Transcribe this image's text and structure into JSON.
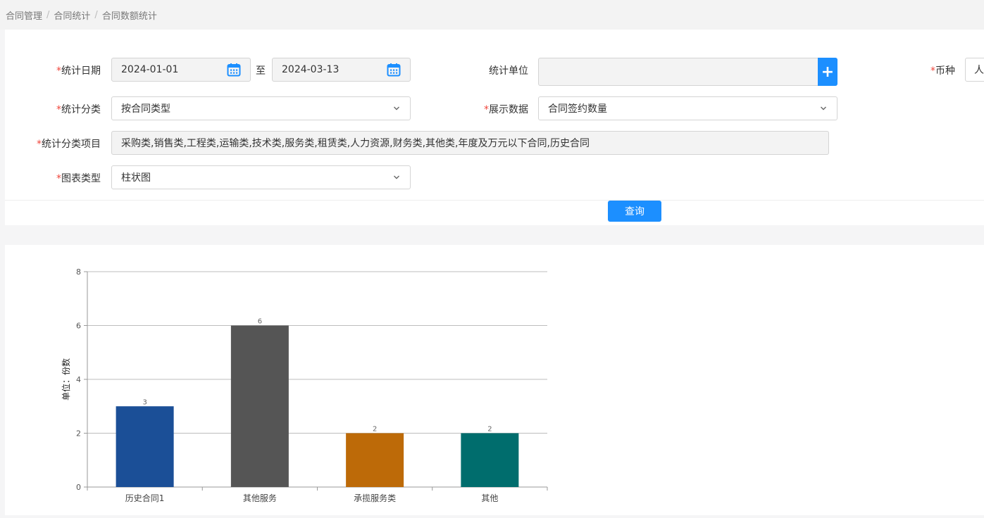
{
  "breadcrumb": [
    "合同管理",
    "合同统计",
    "合同数额统计"
  ],
  "form": {
    "date_label": "统计日期",
    "date_start": "2024-01-01",
    "date_to": "至",
    "date_end": "2024-03-13",
    "unit_label": "统计单位",
    "unit_value": "",
    "currency_label": "币种",
    "currency_value": "人",
    "category_label": "统计分类",
    "category_value": "按合同类型",
    "display_label": "展示数据",
    "display_value": "合同签约数量",
    "items_label": "统计分类项目",
    "items_value": "采购类,销售类,工程类,运输类,技术类,服务类,租赁类,人力资源,财务类,其他类,年度及万元以下合同,历史合同",
    "chart_type_label": "图表类型",
    "chart_type_value": "柱状图",
    "query_button": "查询"
  },
  "chart_data": {
    "type": "bar",
    "categories": [
      "历史合同1",
      "其他服务",
      "承揽服务类",
      "其他"
    ],
    "values": [
      3,
      6,
      2,
      2
    ],
    "colors": [
      "#1b4f97",
      "#555555",
      "#bd6a08",
      "#006d6d"
    ],
    "ylabel": "单位：份数",
    "ylim": [
      0,
      8
    ],
    "yticks": [
      0,
      2,
      4,
      6,
      8
    ],
    "grid": true
  }
}
